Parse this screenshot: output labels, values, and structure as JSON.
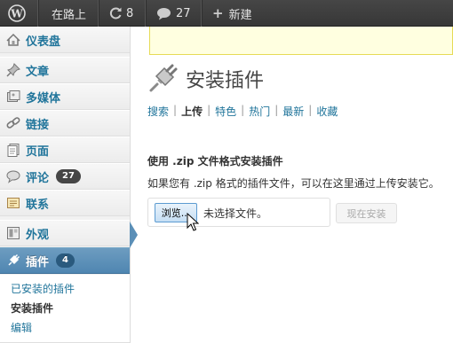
{
  "adminbar": {
    "site_name": "在路上",
    "updates_count": "8",
    "comments_count": "27",
    "new_label": "新建",
    "icons": [
      "wordpress-logo-icon",
      "refresh-icon",
      "comment-bubble-icon",
      "plus-icon"
    ]
  },
  "sidebar": {
    "items": [
      {
        "label": "仪表盘",
        "icon": "dashboard-icon"
      },
      {
        "label": "文章",
        "icon": "pin-icon"
      },
      {
        "label": "多媒体",
        "icon": "media-icon"
      },
      {
        "label": "链接",
        "icon": "link-icon"
      },
      {
        "label": "页面",
        "icon": "page-icon"
      },
      {
        "label": "评论",
        "icon": "comment-icon",
        "badge": "27"
      },
      {
        "label": "联系",
        "icon": "contact-icon"
      },
      {
        "label": "外观",
        "icon": "appearance-icon"
      },
      {
        "label": "插件",
        "icon": "plugin-icon",
        "badge": "4",
        "active": true
      }
    ],
    "submenu": [
      {
        "label": "已安装的插件"
      },
      {
        "label": "安装插件",
        "current": true
      },
      {
        "label": "编辑"
      }
    ]
  },
  "main": {
    "title": "安装插件",
    "tabs": [
      {
        "label": "搜索"
      },
      {
        "label": "上传",
        "current": true
      },
      {
        "label": "特色"
      },
      {
        "label": "热门"
      },
      {
        "label": "最新"
      },
      {
        "label": "收藏"
      }
    ],
    "upload_heading": "使用 .zip 文件格式安装插件",
    "upload_desc": "如果您有 .zip 格式的插件文件，可以在这里通过上传安装它。",
    "browse_label": "浏览...",
    "no_file_label": "未选择文件。",
    "install_label": "现在安装"
  },
  "colors": {
    "accent": "#21759b",
    "active_menu": "#5b8fb7",
    "adminbar": "#464646",
    "notice_bg": "#ffffe0"
  }
}
